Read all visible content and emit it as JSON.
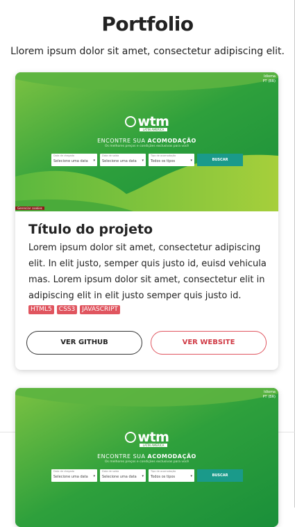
{
  "page": {
    "title": "Portfolio",
    "subtitle": "Llorem ipsum dolor sit amet, consectetur adipiscing elit."
  },
  "projects": [
    {
      "thumbnail": {
        "lang_tag": "Idioma\nPT (BR)",
        "logo": "wtm",
        "logo_sub": "LATIN AMERICA",
        "headline_a": "ENCONTRE SUA ",
        "headline_b": "ACOMODAÇÃO",
        "tagline": "Os melhores preços e condições exclusivas para você",
        "fields": [
          {
            "label": "Data de chegada",
            "value": "Selecione uma data"
          },
          {
            "label": "Data de saída",
            "value": "Selecione uma data"
          },
          {
            "label": "Tipo de acomodação",
            "value": "Todos os tipos"
          }
        ],
        "search_label": "BUSCAR",
        "cookie_label": "Gerenciar cookies"
      },
      "title": "Título do projeto",
      "description": "Lorem ipsum dolor sit amet, consectetur adipiscing elit. In elit justo, semper quis justo id, euisd vehicula mas. Lorem ipsum dolor sit amet, consectetur elit in adipiscing elit in elit justo semper quis justo id.",
      "tags": [
        "HTML5",
        "CSS3",
        "JAVASCRIPT"
      ],
      "github_label": "VER GITHUB",
      "website_label": "VER WEBSITE"
    },
    {
      "thumbnail": {
        "lang_tag": "Idioma\nPT (BR)",
        "logo": "wtm",
        "logo_sub": "LATIN AMERICA",
        "headline_a": "ENCONTRE SUA ",
        "headline_b": "ACOMODAÇÃO",
        "tagline": "Os melhores preços e condições exclusivas para você",
        "fields": [
          {
            "label": "Data de chegada",
            "value": "Selecione uma data"
          },
          {
            "label": "Data de saída",
            "value": "Selecione uma data"
          },
          {
            "label": "Tipo de acomodação",
            "value": "Todos os tipos"
          }
        ],
        "search_label": "BUSCAR"
      }
    }
  ],
  "colors": {
    "green_dark": "#1f9a3a",
    "green_light": "#8cc63f",
    "tag_red": "#e0555f",
    "search_teal": "#1a9a8a"
  }
}
